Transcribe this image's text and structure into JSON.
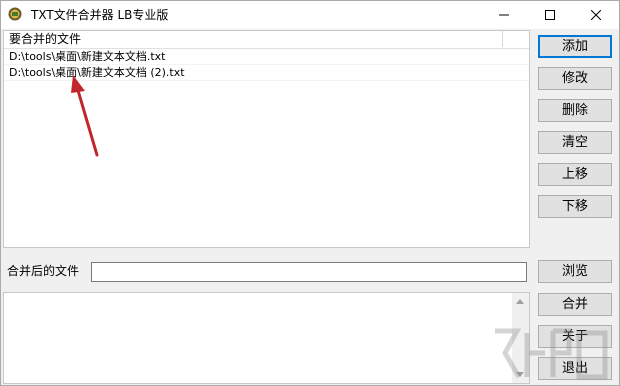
{
  "window": {
    "title": "TXT文件合并器 LB专业版",
    "icon": "app-icon"
  },
  "file_list": {
    "header": "要合并的文件",
    "rows": [
      "D:\\tools\\桌面\\新建文本文档.txt",
      "D:\\tools\\桌面\\新建文本文档 (2).txt"
    ]
  },
  "buttons": {
    "add": "添加",
    "edit": "修改",
    "delete": "删除",
    "clear": "清空",
    "move_up": "上移",
    "move_down": "下移",
    "browse": "浏览",
    "merge": "合并",
    "about": "关于",
    "exit": "退出"
  },
  "output": {
    "label": "合并后的文件",
    "value": ""
  },
  "colors": {
    "primary_border": "#0078d7",
    "arrow": "#c0272d"
  }
}
